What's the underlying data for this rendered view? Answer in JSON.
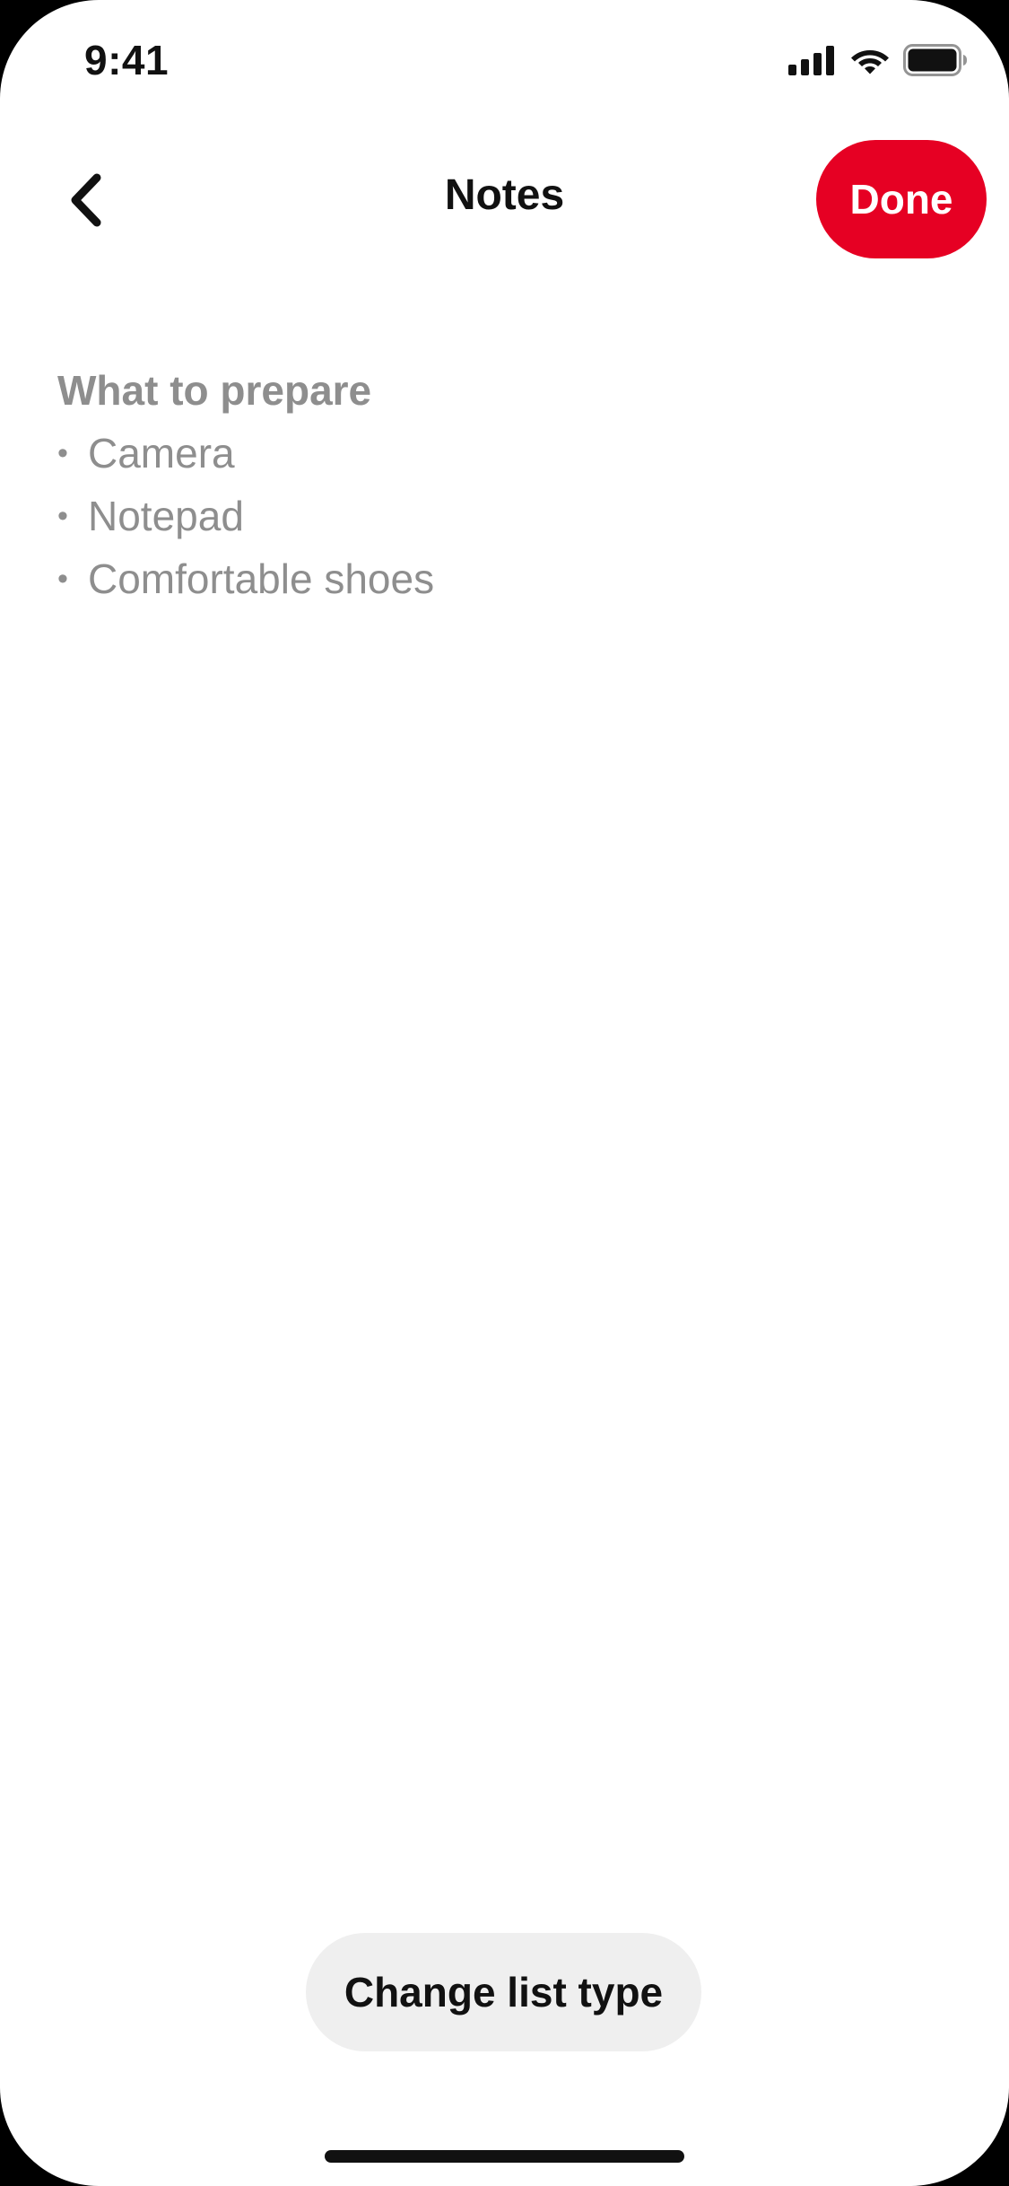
{
  "status_bar": {
    "time": "9:41",
    "icons": [
      "cellular-signal-icon",
      "wifi-icon",
      "battery-icon"
    ]
  },
  "header": {
    "back_icon": "chevron-left-icon",
    "title": "Notes",
    "done_label": "Done"
  },
  "note": {
    "heading": "What to prepare",
    "bullet_symbol": "•",
    "items": [
      "Camera",
      "Notepad",
      "Comfortable shoes"
    ]
  },
  "footer": {
    "change_list_type_label": "Change list type"
  },
  "colors": {
    "accent": "#e60023",
    "placeholder_text": "#8e8e8e",
    "pill_background": "#efefef"
  }
}
